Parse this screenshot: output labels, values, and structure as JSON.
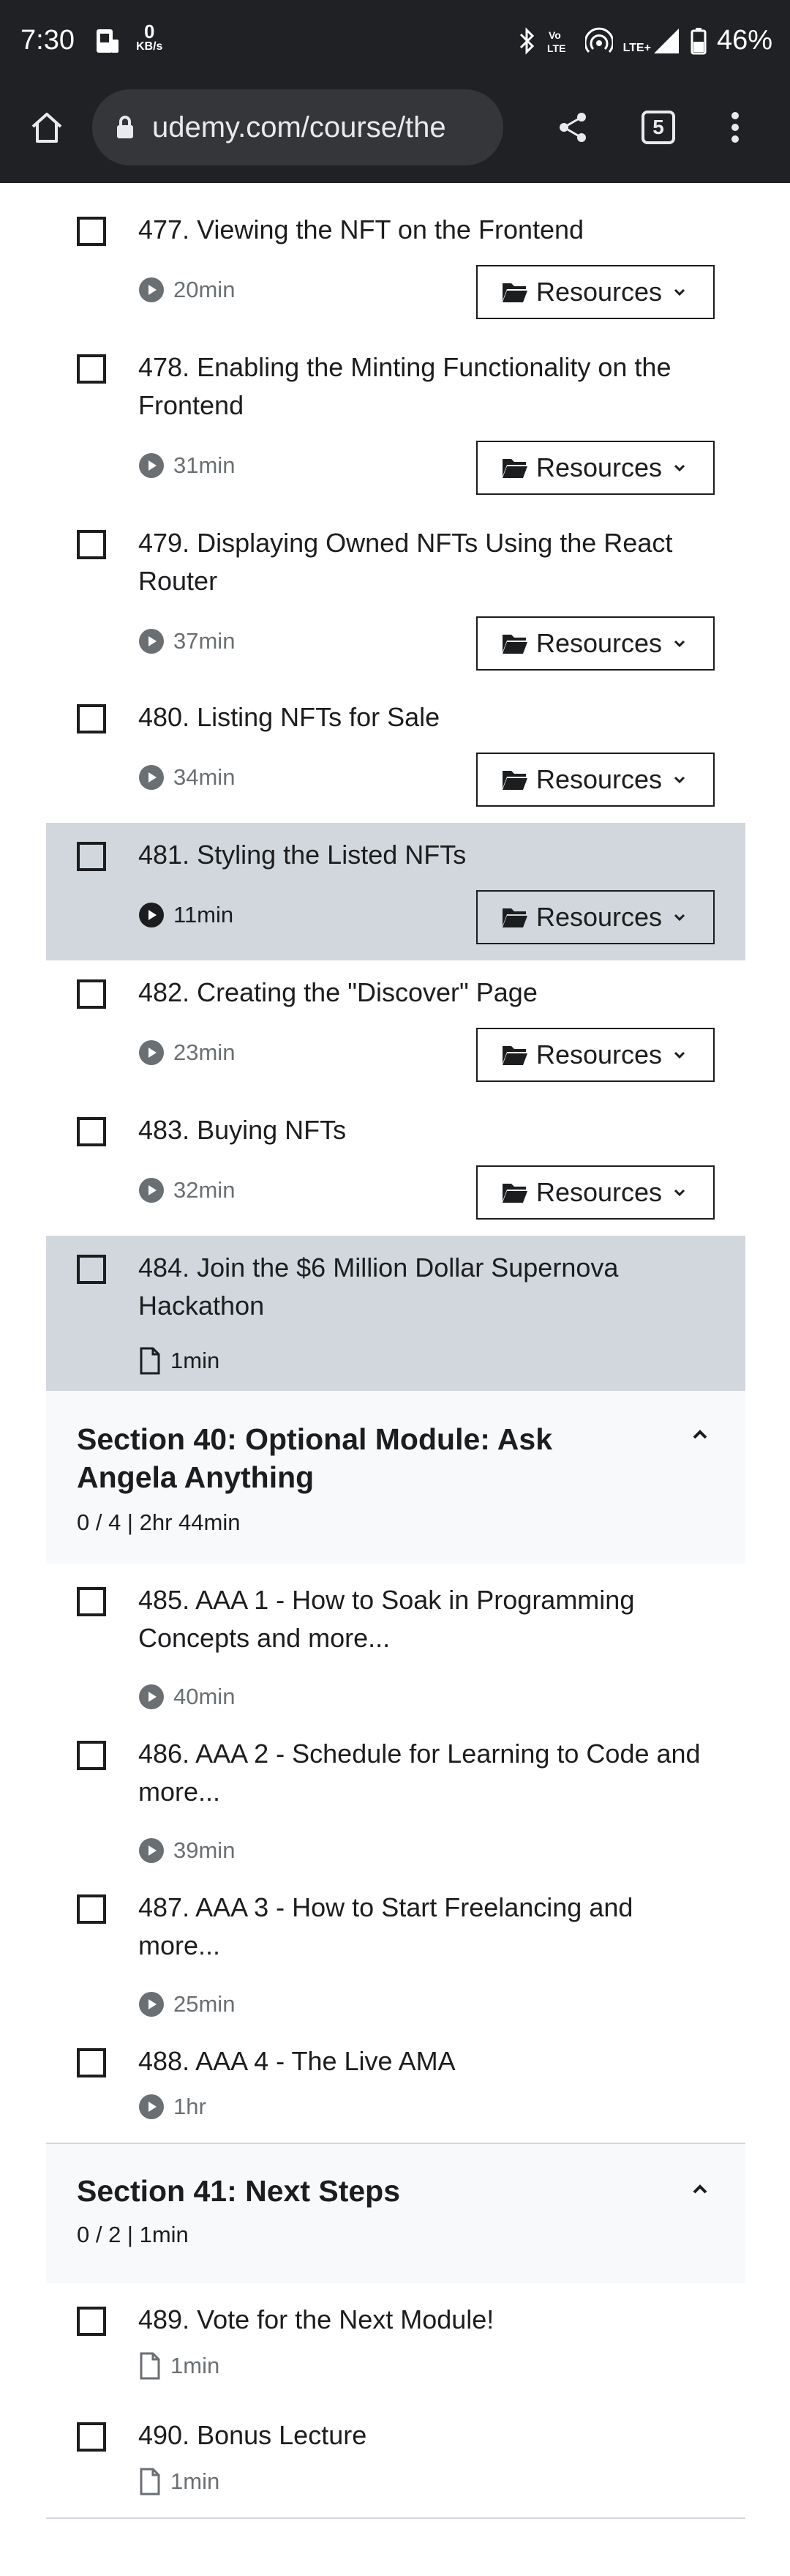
{
  "status_bar": {
    "time": "7:30",
    "speed_value": "0",
    "speed_unit": "KB/s",
    "battery": "46%",
    "network_label": "LTE+"
  },
  "browser": {
    "url": "udemy.com/course/the",
    "tab_count": "5"
  },
  "lectures_a": [
    {
      "title": "477. Viewing the NFT on the Frontend",
      "duration": "20min",
      "kind": "video",
      "resources": "Resources",
      "highlight": false
    },
    {
      "title": "478. Enabling the Minting Functionality on the Frontend",
      "duration": "31min",
      "kind": "video",
      "resources": "Resources",
      "highlight": false
    },
    {
      "title": "479. Displaying Owned NFTs Using the React Router",
      "duration": "37min",
      "kind": "video",
      "resources": "Resources",
      "highlight": false
    },
    {
      "title": "480. Listing NFTs for Sale",
      "duration": "34min",
      "kind": "video",
      "resources": "Resources",
      "highlight": false
    },
    {
      "title": "481. Styling the Listed NFTs",
      "duration": "11min",
      "kind": "video",
      "resources": "Resources",
      "highlight": true
    },
    {
      "title": "482. Creating the \"Discover\" Page",
      "duration": "23min",
      "kind": "video",
      "resources": "Resources",
      "highlight": false
    },
    {
      "title": "483. Buying NFTs",
      "duration": "32min",
      "kind": "video",
      "resources": "Resources",
      "highlight": false
    },
    {
      "title": "484. Join the $6 Million Dollar Supernova Hackathon",
      "duration": "1min",
      "kind": "article",
      "resources": "",
      "highlight": true
    }
  ],
  "section40": {
    "title": "Section 40: Optional Module: Ask Angela Anything",
    "meta": "0 / 4 | 2hr 44min"
  },
  "lectures_b": [
    {
      "title": "485. AAA 1 - How to Soak in Programming Concepts and more...",
      "duration": "40min",
      "kind": "video"
    },
    {
      "title": "486. AAA 2 - Schedule for Learning to Code and more...",
      "duration": "39min",
      "kind": "video"
    },
    {
      "title": "487. AAA 3 - How to Start Freelancing and more...",
      "duration": "25min",
      "kind": "video"
    },
    {
      "title": "488. AAA 4 - The Live AMA",
      "duration": "1hr",
      "kind": "video"
    }
  ],
  "section41": {
    "title": "Section 41: Next Steps",
    "meta": "0 / 2 | 1min"
  },
  "lectures_c": [
    {
      "title": "489. Vote for the Next Module!",
      "duration": "1min",
      "kind": "article"
    },
    {
      "title": "490. Bonus Lecture",
      "duration": "1min",
      "kind": "article"
    }
  ],
  "colors": {
    "highlight": "#d1d7dc",
    "section_bg": "#f7f9fa",
    "chrome_bg": "#202124"
  }
}
